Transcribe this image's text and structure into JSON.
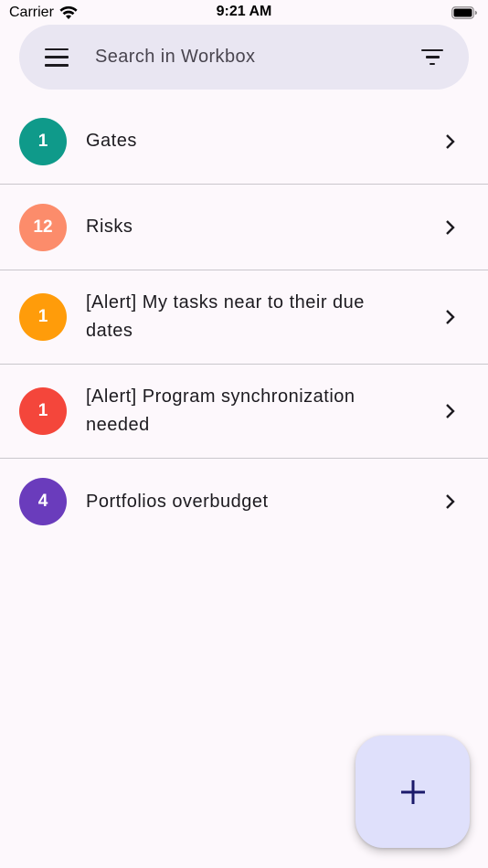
{
  "status_bar": {
    "carrier": "Carrier",
    "time": "9:21 AM"
  },
  "search": {
    "placeholder": "Search in Workbox"
  },
  "items": [
    {
      "count": "1",
      "label": "Gates",
      "color": "#0f9a8a"
    },
    {
      "count": "12",
      "label": "Risks",
      "color": "#fc8c6b"
    },
    {
      "count": "1",
      "label": "[Alert] My tasks near to their due dates",
      "color": "#ff9c0a"
    },
    {
      "count": "1",
      "label": "[Alert] Program synchronization needed",
      "color": "#f4463b"
    },
    {
      "count": "4",
      "label": "Portfolios overbudget",
      "color": "#6a3cbc"
    }
  ],
  "colors": {
    "background": "#fdf8fc",
    "search_bar": "#e9e6f2",
    "fab": "#dfe0fb",
    "fab_icon": "#1b1a6b"
  },
  "icons": {
    "menu": "menu-icon",
    "filter": "filter-icon",
    "chevron": "chevron-right-icon",
    "fab": "plus-icon"
  }
}
